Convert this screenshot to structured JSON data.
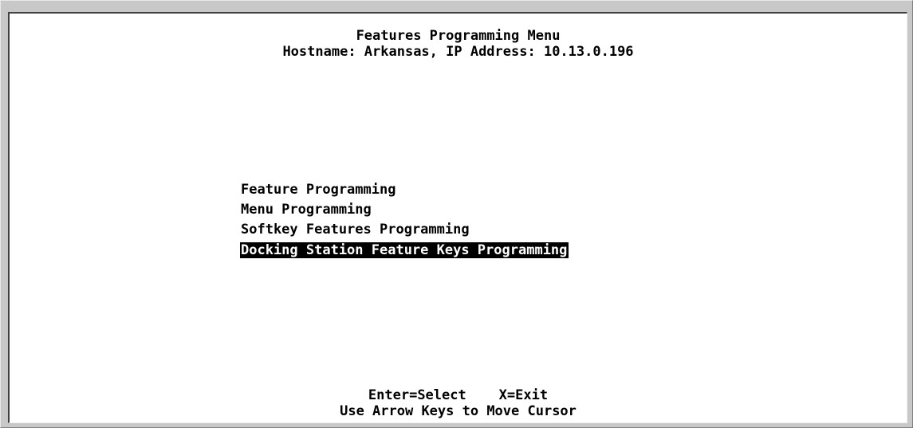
{
  "header": {
    "title": "Features Programming Menu",
    "host_line": "Hostname: Arkansas, IP Address: 10.13.0.196"
  },
  "menu": {
    "items": [
      {
        "label": "Feature Programming",
        "selected": false
      },
      {
        "label": "Menu Programming",
        "selected": false
      },
      {
        "label": "Softkey Features Programming",
        "selected": false
      },
      {
        "label": "Docking Station Feature Keys Programming",
        "selected": true
      }
    ]
  },
  "footer": {
    "keys_line": "Enter=Select    X=Exit",
    "hint_line": "Use Arrow Keys to Move Cursor"
  },
  "colors": {
    "background": "#ffffff",
    "text": "#000000",
    "highlight_bg": "#000000",
    "highlight_text": "#ffffff"
  }
}
